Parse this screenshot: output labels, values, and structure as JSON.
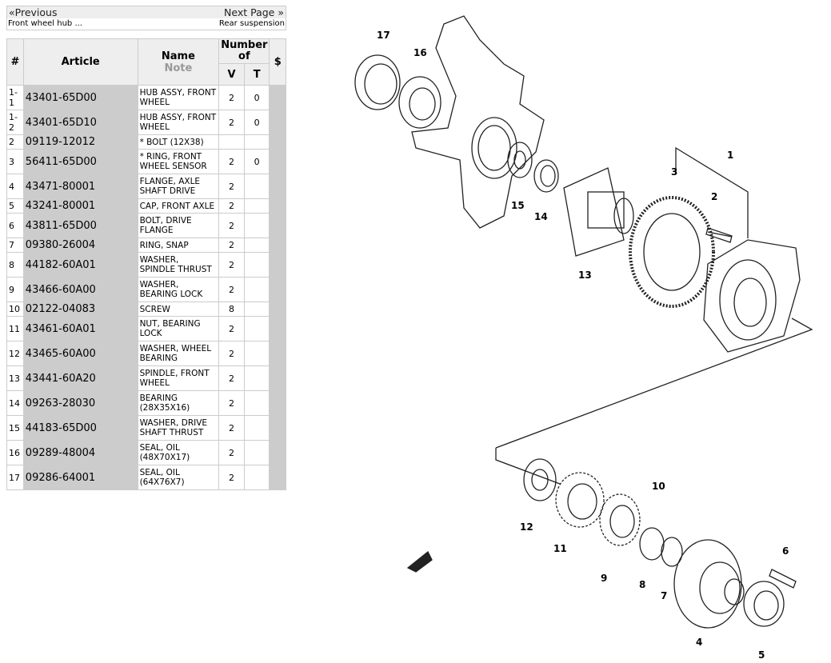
{
  "nav": {
    "previous": "«Previous",
    "next": "Next Page »",
    "previous_title": "Front wheel hub ...",
    "next_title": "Rear suspension"
  },
  "table": {
    "headers": {
      "num": "#",
      "article": "Article",
      "name": "Name",
      "note": "Note",
      "number_of": "Number of",
      "v": "V",
      "t": "T",
      "price": "$"
    },
    "rows": [
      {
        "num": "1-1",
        "article": "43401-65D00",
        "name": "HUB ASSY, FRONT WHEEL",
        "v": "2",
        "t": "0"
      },
      {
        "num": "1-2",
        "article": "43401-65D10",
        "name": "HUB ASSY, FRONT WHEEL",
        "v": "2",
        "t": "0"
      },
      {
        "num": "2",
        "article": "09119-12012",
        "name": "* BOLT (12X38)",
        "v": "",
        "t": ""
      },
      {
        "num": "3",
        "article": "56411-65D00",
        "name": "* RING, FRONT WHEEL SENSOR",
        "v": "2",
        "t": "0"
      },
      {
        "num": "4",
        "article": "43471-80001",
        "name": "FLANGE, AXLE SHAFT DRIVE",
        "v": "2",
        "t": ""
      },
      {
        "num": "5",
        "article": "43241-80001",
        "name": "CAP, FRONT AXLE",
        "v": "2",
        "t": ""
      },
      {
        "num": "6",
        "article": "43811-65D00",
        "name": "BOLT, DRIVE FLANGE",
        "v": "2",
        "t": ""
      },
      {
        "num": "7",
        "article": "09380-26004",
        "name": "RING, SNAP",
        "v": "2",
        "t": ""
      },
      {
        "num": "8",
        "article": "44182-60A01",
        "name": "WASHER, SPINDLE THRUST",
        "v": "2",
        "t": ""
      },
      {
        "num": "9",
        "article": "43466-60A00",
        "name": "WASHER, BEARING LOCK",
        "v": "2",
        "t": ""
      },
      {
        "num": "10",
        "article": "02122-04083",
        "name": "SCREW",
        "v": "8",
        "t": ""
      },
      {
        "num": "11",
        "article": "43461-60A01",
        "name": "NUT, BEARING LOCK",
        "v": "2",
        "t": ""
      },
      {
        "num": "12",
        "article": "43465-60A00",
        "name": "WASHER, WHEEL BEARING",
        "v": "2",
        "t": ""
      },
      {
        "num": "13",
        "article": "43441-60A20",
        "name": "SPINDLE, FRONT WHEEL",
        "v": "2",
        "t": ""
      },
      {
        "num": "14",
        "article": "09263-28030",
        "name": "BEARING (28X35X16)",
        "v": "2",
        "t": ""
      },
      {
        "num": "15",
        "article": "44183-65D00",
        "name": "WASHER, DRIVE SHAFT THRUST",
        "v": "2",
        "t": ""
      },
      {
        "num": "16",
        "article": "09289-48004",
        "name": "SEAL, OIL (48X70X17)",
        "v": "2",
        "t": ""
      },
      {
        "num": "17",
        "article": "09286-64001",
        "name": "SEAL, OIL (64X76X7)",
        "v": "2",
        "t": ""
      }
    ]
  },
  "diagram": {
    "callouts": [
      "17",
      "16",
      "1",
      "3",
      "2",
      "15",
      "14",
      "13",
      "12",
      "11",
      "10",
      "9",
      "8",
      "7",
      "6",
      "4",
      "5"
    ]
  }
}
